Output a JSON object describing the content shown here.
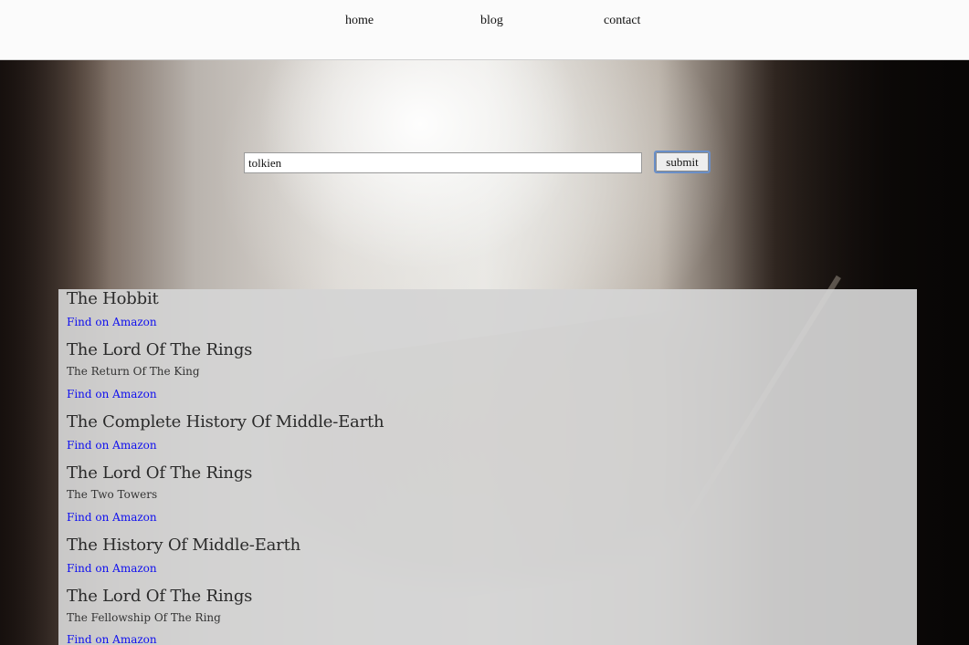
{
  "nav": {
    "items": [
      {
        "label": "home"
      },
      {
        "label": "blog"
      },
      {
        "label": "contact"
      }
    ]
  },
  "search": {
    "value": "tolkien",
    "submit_label": "submit"
  },
  "results": [
    {
      "title": "The Hobbit",
      "subtitle": "",
      "link_label": "Find on Amazon"
    },
    {
      "title": "The Lord Of The Rings",
      "subtitle": "The Return Of The King",
      "link_label": "Find on Amazon"
    },
    {
      "title": "The Complete History Of Middle-Earth",
      "subtitle": "",
      "link_label": "Find on Amazon"
    },
    {
      "title": "The Lord Of The Rings",
      "subtitle": "The Two Towers",
      "link_label": "Find on Amazon"
    },
    {
      "title": "The History Of Middle-Earth",
      "subtitle": "",
      "link_label": "Find on Amazon"
    },
    {
      "title": "The Lord Of The Rings",
      "subtitle": "The Fellowship Of The Ring",
      "link_label": "Find on Amazon"
    }
  ],
  "colors": {
    "link": "#1010ee",
    "panel": "#d4d4d4",
    "nav_background": "#fbfbfb"
  }
}
